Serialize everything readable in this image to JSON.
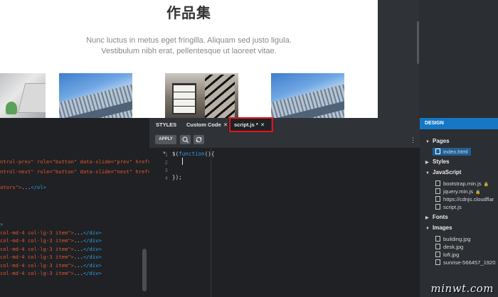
{
  "preview": {
    "title": "作品集",
    "lead_line1": "Nunc luctus in metus eget fringilla. Aliquam sed justo ligula.",
    "lead_line2": "Vestibulum nibh erat, pellentesque ut laoreet vitae."
  },
  "html_code": {
    "line1": {
      "attr": "ntrol-prev\" role=\"button\" data-slide=\"prev\" href=\"#carouse"
    },
    "line2": {
      "attr": "ntrol-next\" role=\"button\" data-slide=\"next\" href=\"#carouse"
    },
    "line3": {
      "attr": "ators\">",
      "rest": "...",
      "tag": "</ol>"
    },
    "items": [
      {
        "attr": "col-md-4 col-lg-3 item\">",
        "rest": "...",
        "tag": "</div>"
      },
      {
        "attr": "col-md-4 col-lg-3 item\">",
        "rest": "...",
        "tag": "</div>"
      },
      {
        "attr": "col-md-4 col-lg-3 item\">",
        "rest": "...",
        "tag": "</div>"
      },
      {
        "attr": "col-md-4 col-lg-3 item\">",
        "rest": "...",
        "tag": "</div>"
      },
      {
        "attr": "col-md-4 col-lg-3 item\">",
        "rest": "...",
        "tag": "</div>"
      },
      {
        "attr": "col-md-4 col-lg-3 item\">",
        "rest": "...",
        "tag": "</div>"
      }
    ]
  },
  "tabs": {
    "styles": "STYLES",
    "custom_code": "Custom Code",
    "script": "script.js *",
    "close": "×"
  },
  "toolbar": {
    "apply": "APPLY",
    "more": "⋮"
  },
  "js_editor": {
    "line_numbers": [
      "1",
      "2",
      "3",
      "4"
    ],
    "line1_pre": "$(",
    "line1_kw": "function",
    "line1_post": "(){",
    "line4": "});"
  },
  "design": {
    "header": "DESIGN",
    "sections": {
      "pages": "Pages",
      "styles": "Styles",
      "javascript": "JavaScript",
      "fonts": "Fonts",
      "images": "Images"
    },
    "pages": [
      "index.html"
    ],
    "javascript_files": [
      "bootstrap.min.js",
      "jquery.min.js",
      "https://cdnjs.cloudflar",
      "script.js"
    ],
    "images": [
      "building.jpg",
      "desk.jpg",
      "loft.jpg",
      "sunrise-566457_1920"
    ]
  },
  "watermark": "minwt.com"
}
